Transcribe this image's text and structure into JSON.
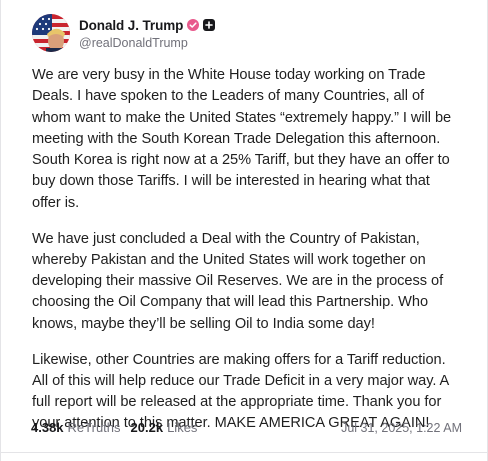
{
  "post": {
    "author": {
      "display_name": "Donald J. Trump",
      "handle": "@realDonaldTrump",
      "avatar_icon": "avatar-flag",
      "verified_icon": "verified-badge-icon",
      "plus_icon": "plus-square-icon"
    },
    "paragraphs": [
      "We are very busy in the White House today working on Trade Deals. I have spoken to the Leaders of many Countries, all of whom want to make the United States “extremely happy.” I will be meeting with the South Korean Trade Delegation this afternoon. South Korea is right now at a 25% Tariff, but they have an offer to buy down those Tariffs. I will be interested in hearing what that offer is.",
      "We have just concluded a Deal with the Country of Pakistan, whereby Pakistan and the United States will work together on developing their massive Oil Reserves. We are in the process of choosing the Oil Company that will lead this Partnership. Who knows, maybe they’ll be selling Oil to India some day!",
      "Likewise, other Countries are making offers for a Tariff reduction. All of this will help reduce our Trade Deficit in a very major way. A full report will be released at the appropriate time. Thank you for your attention to this matter. MAKE AMERICA GREAT AGAIN!"
    ],
    "stats": {
      "retruths_count": "4.38k",
      "retruths_label": "ReTruths",
      "likes_count": "20.2k",
      "likes_label": "Likes"
    },
    "timestamp": "Jul 31, 2025, 1:22 AM"
  },
  "colors": {
    "verified": "#e85a8c",
    "text": "#1f1f1f",
    "muted": "#71717a"
  }
}
